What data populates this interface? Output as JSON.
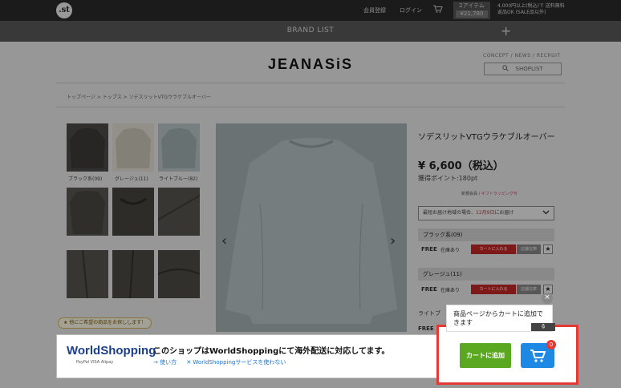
{
  "header": {
    "logo": ".st",
    "nav": [
      "会員登録",
      "ログイン"
    ],
    "cart_items": "2アイテム",
    "cart_total": "¥21,780",
    "free_shipping_line1": "4,000円以上(税込)で 送料無料",
    "free_shipping_line2": "返品OK (SALE品以外)"
  },
  "brand_bar": {
    "label": "BRAND LIST",
    "plus": "+"
  },
  "brand": {
    "name": "JEANASiS",
    "subnav": "CONCEPT / NEWS / RECRUIT",
    "shoplist": "SHOPLIST"
  },
  "breadcrumb": "トップページ  >  トップス  >  ソデスリットVTGウラケブルオーバー",
  "thumbnails": {
    "labels": [
      "ブラック系(09)",
      "グレージュ(11)",
      "ライトブルー(82)"
    ]
  },
  "product": {
    "title": "ソデスリットVTGウラケブルオーバー",
    "price": "¥ 6,600（税込）",
    "points": "獲得ポイント:180pt",
    "mini_a": "新規会員",
    "mini_sep": " / ",
    "mini_b": "ギフトラッピング可",
    "delivery_pre": "最短お届け地域の場合、",
    "delivery_date": "12月9日",
    "delivery_post": "にお届け",
    "variants": [
      {
        "name": "ブラック系(09)",
        "size": "FREE",
        "stock": "在庫あり",
        "add": "カートに入れる",
        "store": "店舗在庫"
      },
      {
        "name": "グレージュ(11)",
        "size": "FREE",
        "stock": "在庫あり",
        "add": "カートに入れる",
        "store": "店舗在庫"
      }
    ],
    "cut_variant": "ライトブ",
    "cut_free": "FREE"
  },
  "search_hint": "★ 他にご希望の商品をお探しします！",
  "worldshopping": {
    "logo": "WorldShopping",
    "pay": "PayPal  VISA  Alipay",
    "message": "このショップはWorldShoppingにて海外配送に対応してます。",
    "link_howto": "→ 使い方",
    "link_disable": "✕ WorldShoppingサービスを使わない"
  },
  "cart_popup": {
    "message": "商品ページからカートに追加できます",
    "close": "×",
    "ribbon": "る"
  },
  "cart_widget": {
    "add_label": "カートに追加",
    "badge_count": "0",
    "accent_green": "#5aa81f",
    "accent_blue": "#1e88e5",
    "highlight_color": "#e53935"
  },
  "icons": [
    "cart-icon",
    "search-icon",
    "chevron-down-icon",
    "star-icon",
    "chevron-left-icon",
    "chevron-right-icon",
    "close-icon"
  ]
}
